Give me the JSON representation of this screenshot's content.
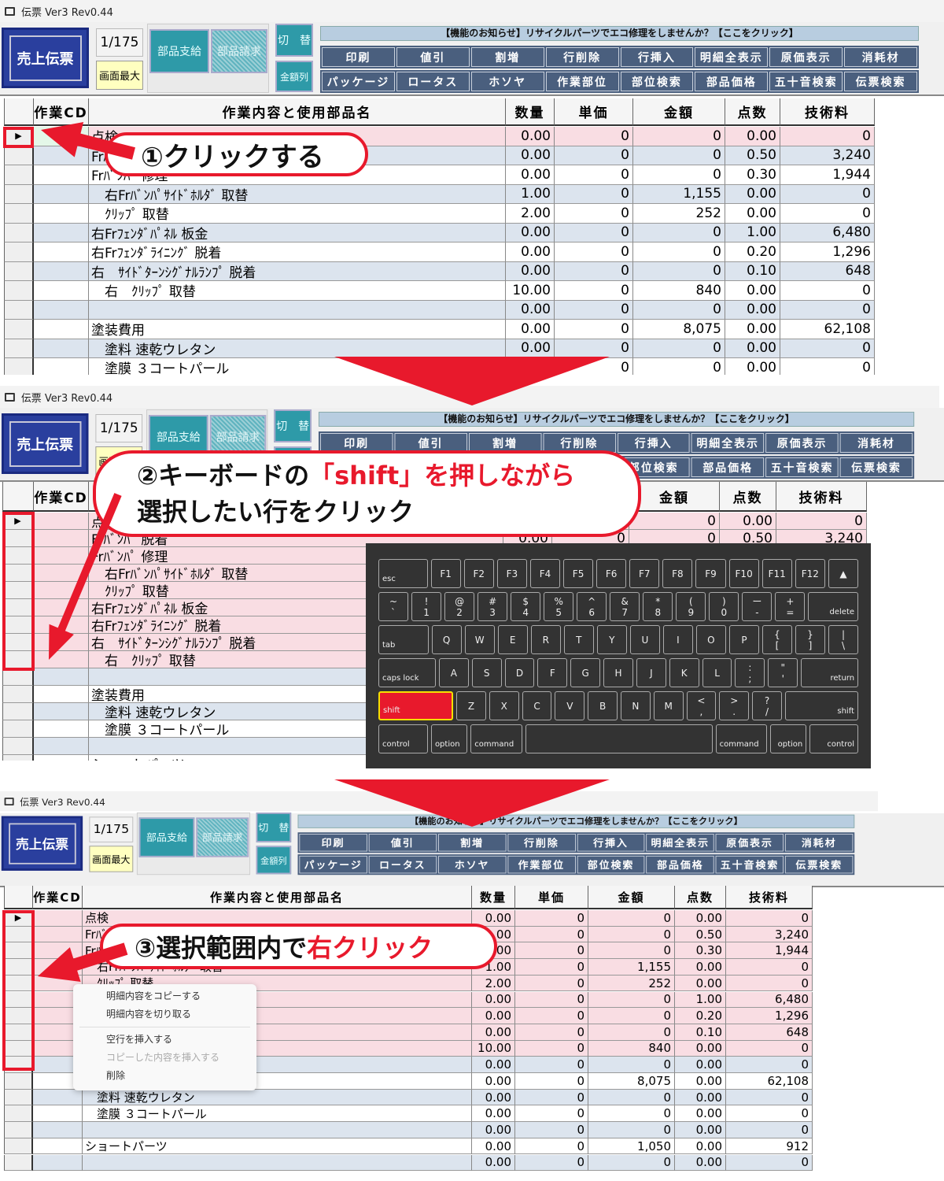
{
  "app": {
    "title": "伝票 Ver3 Rev0.44"
  },
  "header": {
    "main_button": "売上伝票",
    "page_counter": "1/175",
    "maximize": "画面最大",
    "parts_supply": "部品支給",
    "parts_claim": "部品請求",
    "switch": "切　替",
    "amount_column": "金額列",
    "notice": "【機能のお知らせ】リサイクルパーツでエコ修理をしませんか？【ここをクリック】",
    "toolbar_row1": [
      "印刷",
      "値引",
      "割増",
      "行削除",
      "行挿入",
      "明細全表示",
      "原価表示",
      "消耗材"
    ],
    "toolbar_row2": [
      "パッケージ",
      "ロータス",
      "ホソヤ",
      "作業部位",
      "部位検索",
      "部品価格",
      "五十音検索",
      "伝票検索"
    ]
  },
  "table": {
    "columns": [
      "",
      "作業CD",
      "作業内容と使用部品名",
      "数量",
      "単価",
      "金額",
      "点数",
      "技術料"
    ],
    "rows": [
      [
        "点検",
        "0.00",
        "0",
        "0",
        "0.00",
        "0"
      ],
      [
        "Frﾊﾞﾝﾊﾟ 脱着",
        "0.00",
        "0",
        "0",
        "0.50",
        "3,240"
      ],
      [
        "Frﾊﾞﾝﾊﾟ 修理",
        "0.00",
        "0",
        "0",
        "0.30",
        "1,944"
      ],
      [
        "　右Frﾊﾞﾝﾊﾟｻｲﾄﾞﾎﾙﾀﾞ 取替",
        "1.00",
        "0",
        "1,155",
        "0.00",
        "0"
      ],
      [
        "　ｸﾘｯﾌﾟ 取替",
        "2.00",
        "0",
        "252",
        "0.00",
        "0"
      ],
      [
        "右Frﾌｪﾝﾀﾞﾊﾟﾈﾙ 板金",
        "0.00",
        "0",
        "0",
        "1.00",
        "6,480"
      ],
      [
        "右Frﾌｪﾝﾀﾞﾗｲﾆﾝｸﾞ 脱着",
        "0.00",
        "0",
        "0",
        "0.20",
        "1,296"
      ],
      [
        "右　ｻｲﾄﾞﾀｰﾝｼｸﾞﾅﾙﾗﾝﾌﾟ 脱着",
        "0.00",
        "0",
        "0",
        "0.10",
        "648"
      ],
      [
        "　右　ｸﾘｯﾌﾟ 取替",
        "10.00",
        "0",
        "840",
        "0.00",
        "0"
      ],
      [
        "",
        "0.00",
        "0",
        "0",
        "0.00",
        "0"
      ],
      [
        "塗装費用",
        "0.00",
        "0",
        "8,075",
        "0.00",
        "62,108"
      ],
      [
        "　塗料 速乾ウレタン",
        "0.00",
        "0",
        "0",
        "0.00",
        "0"
      ],
      [
        "　塗膜 ３コートパール",
        "0.00",
        "0",
        "0",
        "0.00",
        "0"
      ],
      [
        "",
        "0.00",
        "0",
        "0",
        "0.00",
        "0"
      ],
      [
        "ショートパーツ",
        "0.00",
        "0",
        "1,050",
        "0.00",
        "912"
      ],
      [
        "",
        "0.00",
        "0",
        "0",
        "0.00",
        "0"
      ]
    ]
  },
  "steps": {
    "step1": "①クリックする",
    "step2_a": "②キーボードの",
    "step2_b": "「shift」を押しながら",
    "step2_c": "選択したい行をクリック",
    "step3_a": "③選択範囲内で",
    "step3_b": "右クリック"
  },
  "keyboard": {
    "highlighted_key": "shift",
    "rows": [
      [
        [
          "",
          "esc"
        ],
        [
          "",
          "F1"
        ],
        [
          "",
          "F2"
        ],
        [
          "",
          "F3"
        ],
        [
          "",
          "F4"
        ],
        [
          "",
          "F5"
        ],
        [
          "",
          "F6"
        ],
        [
          "",
          "F7"
        ],
        [
          "",
          "F8"
        ],
        [
          "",
          "F9"
        ],
        [
          "",
          "F10"
        ],
        [
          "",
          "F11"
        ],
        [
          "",
          "F12"
        ],
        [
          "",
          "▲"
        ]
      ],
      [
        [
          "~",
          "`"
        ],
        [
          "!",
          "1"
        ],
        [
          "@",
          "2"
        ],
        [
          "#",
          "3"
        ],
        [
          "$",
          "4"
        ],
        [
          "%",
          "5"
        ],
        [
          "^",
          "6"
        ],
        [
          "&",
          "7"
        ],
        [
          "*",
          "8"
        ],
        [
          "(",
          "9"
        ],
        [
          ")",
          "0"
        ],
        [
          "ー",
          "-"
        ],
        [
          "+",
          "="
        ],
        [
          "",
          "delete"
        ]
      ],
      [
        [
          "",
          "tab"
        ],
        [
          "",
          "Q"
        ],
        [
          "",
          "W"
        ],
        [
          "",
          "E"
        ],
        [
          "",
          "R"
        ],
        [
          "",
          "T"
        ],
        [
          "",
          "Y"
        ],
        [
          "",
          "U"
        ],
        [
          "",
          "I"
        ],
        [
          "",
          "O"
        ],
        [
          "",
          "P"
        ],
        [
          "{",
          "["
        ],
        [
          "}",
          "]"
        ],
        [
          "|",
          "\\"
        ]
      ],
      [
        [
          "",
          "caps lock"
        ],
        [
          "",
          "A"
        ],
        [
          "",
          "S"
        ],
        [
          "",
          "D"
        ],
        [
          "",
          "F"
        ],
        [
          "",
          "G"
        ],
        [
          "",
          "H"
        ],
        [
          "",
          "J"
        ],
        [
          "",
          "K"
        ],
        [
          "",
          "L"
        ],
        [
          ":",
          ";"
        ],
        [
          "\"",
          "'"
        ],
        [
          "",
          "return"
        ]
      ],
      [
        [
          "",
          "shift"
        ],
        [
          "",
          "Z"
        ],
        [
          "",
          "X"
        ],
        [
          "",
          "C"
        ],
        [
          "",
          "V"
        ],
        [
          "",
          "B"
        ],
        [
          "",
          "N"
        ],
        [
          "",
          "M"
        ],
        [
          "<",
          ","
        ],
        [
          ">",
          "."
        ],
        [
          "?",
          "/"
        ],
        [
          "",
          "shift"
        ]
      ],
      [
        [
          "",
          "control"
        ],
        [
          "",
          "option"
        ],
        [
          "",
          "command"
        ],
        [
          "",
          ""
        ],
        [
          "",
          "command"
        ],
        [
          "",
          "option"
        ],
        [
          "",
          "control"
        ]
      ]
    ]
  },
  "context_menu": {
    "items": [
      {
        "label": "明細内容をコピーする",
        "enabled": true
      },
      {
        "label": "明細内容を切り取る",
        "enabled": true
      },
      {
        "label": "空行を挿入する",
        "enabled": true
      },
      {
        "label": "コピーした内容を挿入する",
        "enabled": false
      },
      {
        "label": "削除",
        "enabled": true
      }
    ]
  },
  "colors": {
    "accent_red": "#e8192c",
    "selected_row": "#f9dde3",
    "alt_row": "#dce4ee",
    "toolbar": "#4a5f7e",
    "teal_button": "#2e9aa8",
    "main_button": "#2a3f9e"
  }
}
